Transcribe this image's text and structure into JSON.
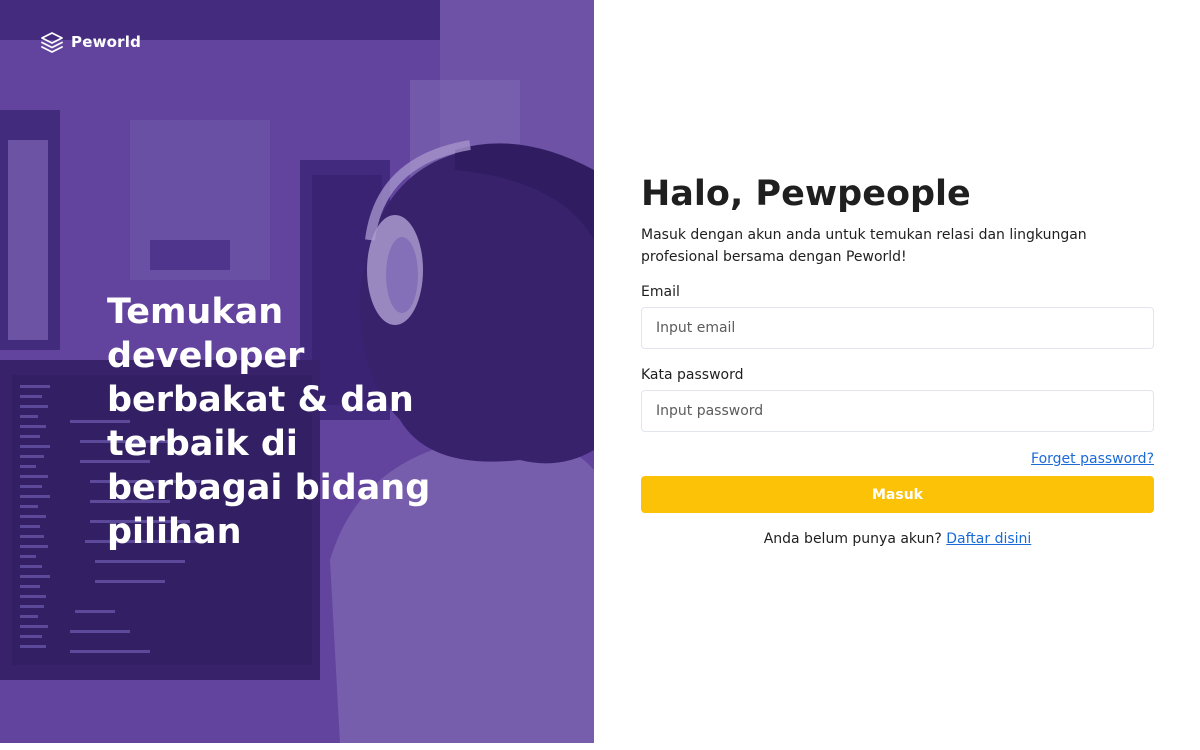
{
  "brand": {
    "name": "Peworld",
    "icon": "stacked-layers-icon"
  },
  "hero": {
    "title": "Temukan developer berbakat & dan terbaik di berbagai bidang pilihan",
    "overlay_color": "#5a3b95"
  },
  "form": {
    "greeting": "Halo, Pewpeople",
    "subtitle": "Masuk dengan akun anda untuk temukan relasi dan lingkungan profesional bersama dengan Peworld!",
    "email": {
      "label": "Email",
      "placeholder": "Input email",
      "value": ""
    },
    "password": {
      "label": "Kata password",
      "placeholder": "Input password",
      "value": ""
    },
    "forget_link": "Forget password?",
    "submit_label": "Masuk",
    "register_prompt": "Anda belum punya akun?",
    "register_link": "Daftar disini"
  },
  "colors": {
    "accent": "#fbc207",
    "link": "#1a6ad8",
    "hero_purple": "#5a3b95"
  }
}
